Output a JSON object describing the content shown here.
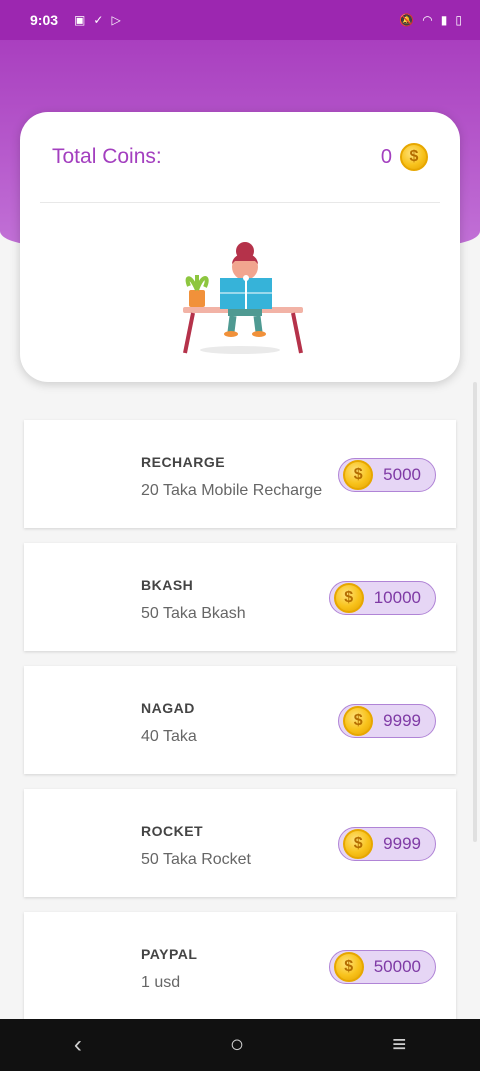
{
  "status": {
    "time": "9:03",
    "left_icons": [
      "camera-icon",
      "check-icon",
      "play-icon"
    ],
    "right_icons": [
      "mute-icon",
      "wifi-icon",
      "signal-icon",
      "battery-icon"
    ]
  },
  "header_card": {
    "label": "Total Coins:",
    "value": "0"
  },
  "rewards": [
    {
      "title": "RECHARGE",
      "desc": "20 Taka Mobile Recharge",
      "cost": "5000"
    },
    {
      "title": "BKASH",
      "desc": "50 Taka Bkash",
      "cost": "10000"
    },
    {
      "title": "NAGAD",
      "desc": "40 Taka",
      "cost": "9999"
    },
    {
      "title": "ROCKET",
      "desc": "50 Taka Rocket",
      "cost": "9999"
    },
    {
      "title": "PAYPAL",
      "desc": "1 usd",
      "cost": "50000"
    }
  ],
  "colors": {
    "accent": "#9c27b0",
    "pill_bg": "#e6d6f5",
    "coin": "#f8c21b"
  },
  "nav": {
    "back_icon": "back-icon",
    "home_icon": "home-icon",
    "menu_icon": "menu-icon"
  }
}
